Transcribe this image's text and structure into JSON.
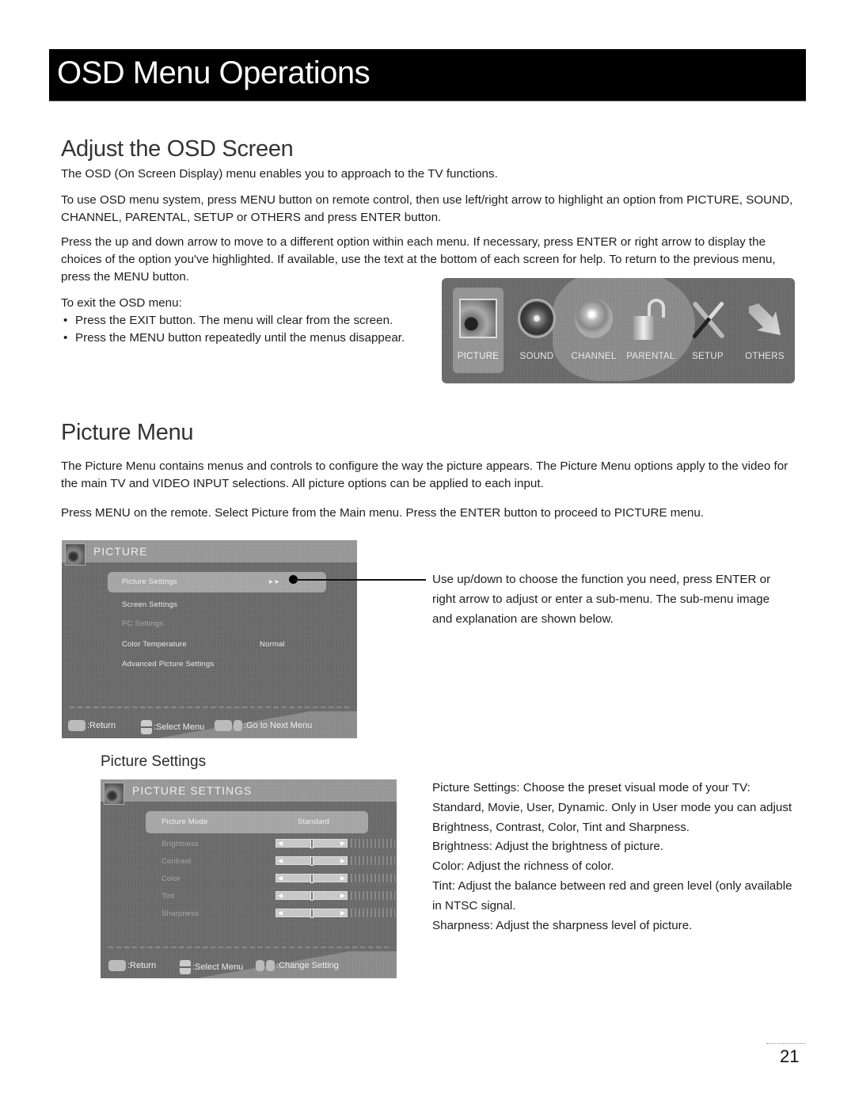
{
  "header": {
    "title": "OSD Menu Operations"
  },
  "adjust_section": {
    "title": "Adjust the OSD Screen",
    "paragraphs": [
      "The OSD (On Screen Display) menu enables you to approach to the TV functions.",
      "To use OSD menu system, press MENU button on remote control, then use left/right arrow to highlight an option from PICTURE, SOUND, CHANNEL, PARENTAL, SETUP or OTHERS and press ENTER button.",
      "Press the up and down arrow to move to a different option within each menu. If necessary, press ENTER or right arrow to display the choices of the option you've highlighted. If available, use the text at the bottom of each screen for help. To return to the previous menu, press the MENU button."
    ],
    "exit_intro": "To exit the OSD menu:",
    "exit_bullets": [
      "Press the EXIT button. The menu will clear from the screen.",
      "Press the MENU button repeatedly until the menus disappear."
    ]
  },
  "main_menu": {
    "selected": "PICTURE",
    "items": [
      {
        "label": "PICTURE",
        "icon": "picture-icon"
      },
      {
        "label": "SOUND",
        "icon": "speaker-icon"
      },
      {
        "label": "CHANNEL",
        "icon": "globe-icon"
      },
      {
        "label": "PARENTAL",
        "icon": "padlock-icon"
      },
      {
        "label": "SETUP",
        "icon": "tools-icon"
      },
      {
        "label": "OTHERS",
        "icon": "arrow-icon"
      }
    ]
  },
  "picture_section": {
    "title": "Picture Menu",
    "paragraphs": [
      "The Picture Menu contains menus and controls to configure the way the picture appears. The Picture Menu options apply to the video for the main TV and VIDEO INPUT selections. All picture options can be applied to each input.",
      "Press MENU on the remote. Select Picture from the Main menu. Press the ENTER button to proceed to PICTURE menu."
    ],
    "callout": "Use up/down to choose the function you need, press ENTER or right arrow to adjust or enter a sub-menu. The sub-menu image and explanation are shown below."
  },
  "picture_osd": {
    "title": "PICTURE",
    "rows": [
      {
        "label": "Picture Settings",
        "value": "▸ ▸",
        "state": "highlighted"
      },
      {
        "label": "Screen Settings",
        "value": "",
        "state": "normal"
      },
      {
        "label": "PC Settings",
        "value": "",
        "state": "disabled"
      },
      {
        "label": "Color Temperature",
        "value": "Normal",
        "state": "normal"
      },
      {
        "label": "Advanced Picture Settings",
        "value": "",
        "state": "normal"
      }
    ],
    "footer": [
      {
        "key": "MENU",
        "label": ":Return"
      },
      {
        "key": "UP/DOWN",
        "label": ":Select Menu"
      },
      {
        "key": "ENTER/▶",
        "label": ":Go to Next Menu"
      }
    ]
  },
  "picture_settings_section": {
    "title": "Picture Settings",
    "description": [
      "Picture Settings: Choose the preset visual mode of your TV: Standard, Movie, User, Dynamic. Only in User mode you can adjust Brightness, Contrast, Color, Tint and Sharpness.",
      "Brightness: Adjust the brightness of picture.",
      "Color: Adjust the richness of color.",
      "Tint: Adjust the balance between red and green level (only available in NTSC signal.",
      "Sharpness: Adjust the sharpness level of picture."
    ]
  },
  "picture_settings_osd": {
    "title": "PICTURE SETTINGS",
    "mode": {
      "label": "Picture Mode",
      "value": "Standard"
    },
    "sliders": [
      {
        "label": "Brightness",
        "value_fraction": 0.5
      },
      {
        "label": "Contrast",
        "value_fraction": 0.5
      },
      {
        "label": "Color",
        "value_fraction": 0.5
      },
      {
        "label": "Tint",
        "value_fraction": 0.5
      },
      {
        "label": "Sharpness",
        "value_fraction": 0.5
      }
    ],
    "footer": [
      {
        "key": "MENU",
        "label": ":Return"
      },
      {
        "key": "UP/DOWN",
        "label": ":Select Menu"
      },
      {
        "key": "LEFT/RIGHT",
        "label": ":Change Setting"
      }
    ]
  },
  "page_number": "21"
}
